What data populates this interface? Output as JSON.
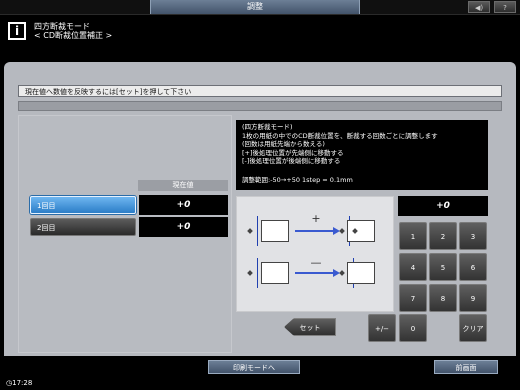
{
  "titlebar": {
    "title": "調整",
    "icon_left": "◀)",
    "icon_right": "?"
  },
  "header": {
    "info_icon": "i",
    "line1": "四方断裁モード",
    "line2": "< CD断裁位置補正 >"
  },
  "instruction": "現在値へ数値を反映するには[セット]を押して下さい",
  "table": {
    "column_header": "現在値",
    "rows": [
      {
        "label": "1回目",
        "value": "+0",
        "selected": true
      },
      {
        "label": "2回目",
        "value": "+0",
        "selected": false
      }
    ]
  },
  "description": {
    "lines": [
      "(四方断裁モード)",
      "1枚の用紙の中でのCD断裁位置を、断裁する回数ごとに調整します",
      "(回数は用紙先端から数える)",
      "[+]後処理位置が先端側に移動する",
      "[-]後処理位置が後端側に移動する"
    ],
    "range": "調整範囲:-50→+50 1step = 0.1mm"
  },
  "diagram": {
    "plus_sign": "+",
    "minus_sign": "—"
  },
  "keypad": {
    "display": "+0",
    "keys": [
      "1",
      "2",
      "3",
      "4",
      "5",
      "6",
      "7",
      "8",
      "9"
    ],
    "plus_minus": "+/−",
    "zero": "0",
    "clear": "クリア",
    "set": "セット"
  },
  "footer": {
    "print_mode": "印刷モードへ",
    "back": "前画面",
    "clock": "17:28"
  },
  "colors": {
    "accent": "#2b7dc7",
    "panel": "#b6b9bf",
    "titlebar": "#42536a"
  }
}
